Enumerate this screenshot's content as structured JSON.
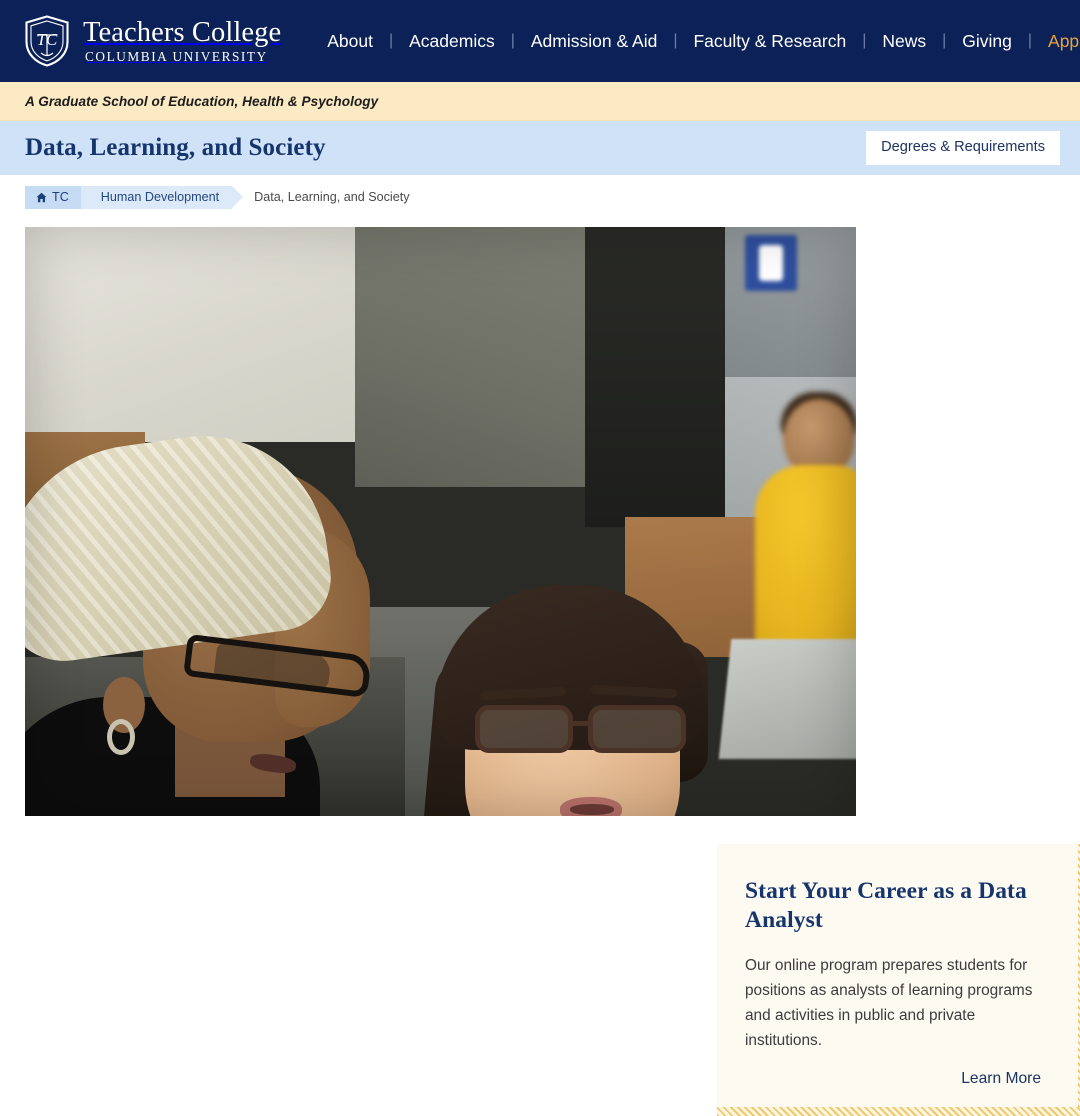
{
  "header": {
    "brand": {
      "name": "Teachers College",
      "sub": "COLUMBIA UNIVERSITY",
      "shield_icon": "tc-shield-icon"
    },
    "nav": [
      {
        "label": "About",
        "highlight": false
      },
      {
        "label": "Academics",
        "highlight": false
      },
      {
        "label": "Admission & Aid",
        "highlight": false
      },
      {
        "label": "Faculty & Research",
        "highlight": false
      },
      {
        "label": "News",
        "highlight": false
      },
      {
        "label": "Giving",
        "highlight": false
      },
      {
        "label": "Apply",
        "highlight": true
      }
    ],
    "separator": "|",
    "colors": {
      "background": "#0b2158",
      "apply_accent": "#e8a33d"
    }
  },
  "tagline": {
    "text": "A Graduate School of Education, Health & Psychology",
    "background": "#fbeac3"
  },
  "titlebar": {
    "title": "Data, Learning, and Society",
    "button_label": "Degrees & Requirements",
    "background": "#cfe2f8",
    "title_color": "#17356d"
  },
  "breadcrumb": {
    "home_icon": "home-icon",
    "items": [
      {
        "label": "TC",
        "current": false
      },
      {
        "label": "Human Development",
        "current": false
      },
      {
        "label": "Data, Learning, and Society",
        "current": true
      }
    ]
  },
  "hero": {
    "photo_alt": "Two students working together at laptops in a classroom",
    "callout": {
      "title": "Start Your Career as a Data Analyst",
      "body": "Our online program prepares students for positions as analysts of learning programs and activities in public and private institutions.",
      "link_label": "Learn More",
      "background": "#fdfaf2",
      "border_color": "#efc96b",
      "title_color": "#17356d"
    }
  }
}
